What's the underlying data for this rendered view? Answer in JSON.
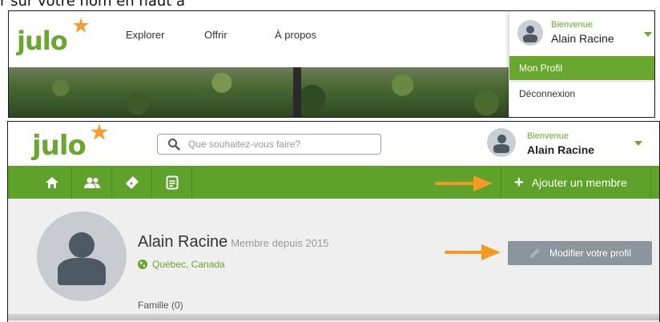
{
  "caption": "r sur votre nom en haut à",
  "screen1": {
    "logo": {
      "text": "julo"
    },
    "nav": [
      {
        "label": "Explorer"
      },
      {
        "label": "Offrir"
      },
      {
        "label": "À propos"
      }
    ],
    "user_menu": {
      "welcome": "Bienvenue",
      "name": "Alain Racine",
      "items": [
        {
          "label": "Mon Profil"
        },
        {
          "label": "Déconnexion"
        }
      ]
    }
  },
  "screen2": {
    "logo": {
      "text": "julo"
    },
    "search": {
      "placeholder": "Que souhaitez-vous faire?"
    },
    "user": {
      "welcome": "Bienvenue",
      "name": "Alain Racine"
    },
    "toolbar": {
      "icons": [
        "home-icon",
        "users-icon",
        "ticket-icon",
        "document-icon"
      ],
      "add_member": "Ajouter un membre"
    },
    "profile": {
      "name": "Alain Racine",
      "member_since": "Membre depuis 2015",
      "location": "Québec, Canada",
      "edit_button": "Modifier votre profil",
      "family": "Famille (0)"
    }
  },
  "colors": {
    "brand_green": "#6aa730",
    "toolbar_green": "#5ea22b",
    "brand_orange": "#f49b2d",
    "edit_button": "#8a959e",
    "arrow": "#f39a25"
  }
}
